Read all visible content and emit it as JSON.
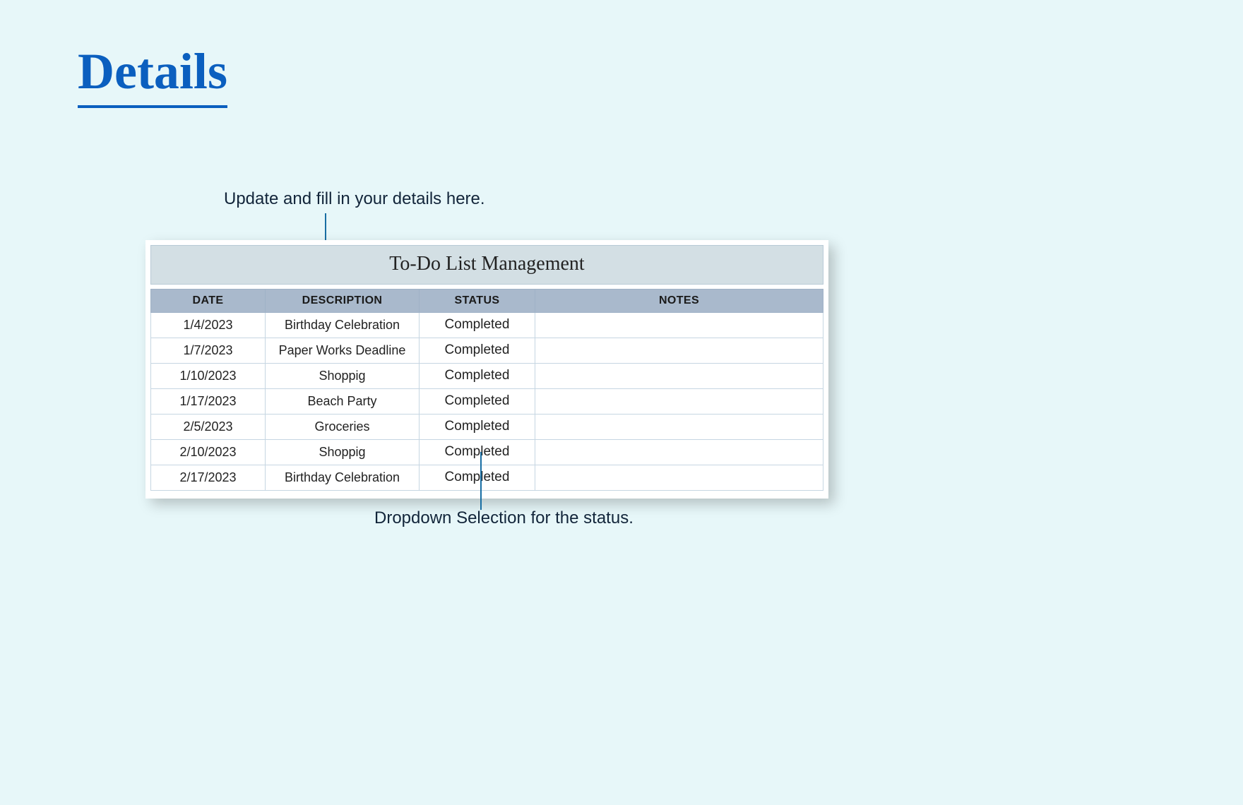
{
  "page_heading": "Details",
  "annotations": {
    "top": "Update and fill in your details here.",
    "bottom": "Dropdown Selection for the status."
  },
  "sheet": {
    "title": "To-Do List Management",
    "columns": [
      "DATE",
      "DESCRIPTION",
      "STATUS",
      "NOTES"
    ],
    "rows": [
      {
        "date": "1/4/2023",
        "description": "Birthday Celebration",
        "status": "Completed",
        "notes": ""
      },
      {
        "date": "1/7/2023",
        "description": "Paper Works Deadline",
        "status": "Completed",
        "notes": ""
      },
      {
        "date": "1/10/2023",
        "description": "Shoppig",
        "status": "Completed",
        "notes": ""
      },
      {
        "date": "1/17/2023",
        "description": "Beach Party",
        "status": "Completed",
        "notes": ""
      },
      {
        "date": "2/5/2023",
        "description": "Groceries",
        "status": "Completed",
        "notes": ""
      },
      {
        "date": "2/10/2023",
        "description": "Shoppig",
        "status": "Completed",
        "notes": ""
      },
      {
        "date": "2/17/2023",
        "description": "Birthday Celebration",
        "status": "Completed",
        "notes": ""
      }
    ]
  }
}
